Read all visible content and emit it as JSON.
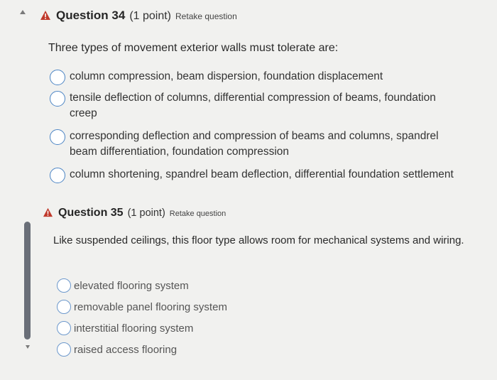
{
  "q34": {
    "title": "Question 34",
    "points": "(1 point)",
    "retake": "Retake question",
    "prompt": "Three types of movement exterior walls must tolerate are:",
    "options": [
      "column compression, beam dispersion, foundation displacement",
      "tensile deflection of columns, differential compression of beams, foundation creep",
      "corresponding deflection and compression of beams and columns, spandrel beam differentiation, foundation compression",
      "column shortening, spandrel beam deflection, differential foundation settlement"
    ]
  },
  "q35": {
    "title": "Question 35",
    "points": "(1 point)",
    "retake": "Retake question",
    "prompt": "Like suspended ceilings, this floor type allows room for mechanical systems and wiring.",
    "options": [
      "elevated flooring system",
      "removable panel flooring system",
      "interstitial flooring system",
      "raised access flooring"
    ]
  },
  "colors": {
    "warning": "#c0392b",
    "radio_border": "#4b84c4",
    "background": "#f1f1ef"
  }
}
